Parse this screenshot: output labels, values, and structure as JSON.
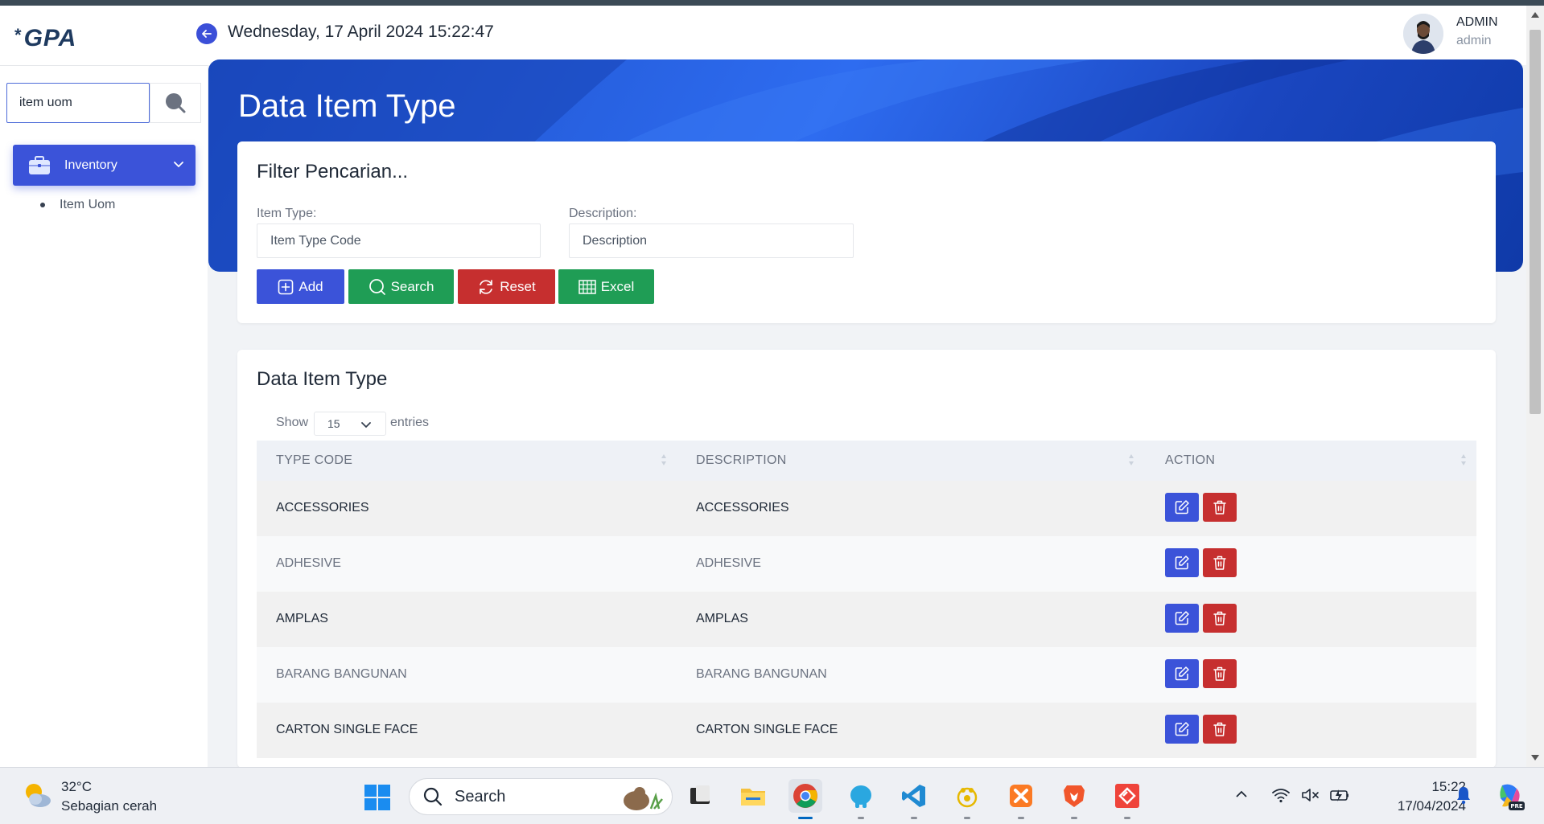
{
  "header": {
    "logo": "GPA",
    "datetime": "Wednesday, 17 April 2024 15:22:47",
    "user_name": "ADMIN",
    "user_role": "admin"
  },
  "sidebar": {
    "search_value": "item uom",
    "menu": {
      "label": "Inventory"
    },
    "sub_items": [
      {
        "label": "Item Uom"
      }
    ]
  },
  "page": {
    "title": "Data Item Type"
  },
  "filter": {
    "title": "Filter Pencarian...",
    "item_type_label": "Item Type:",
    "item_type_placeholder": "Item Type Code",
    "description_label": "Description:",
    "description_placeholder": "Description",
    "buttons": {
      "add": "Add",
      "search": "Search",
      "reset": "Reset",
      "excel": "Excel"
    }
  },
  "table": {
    "title": "Data Item Type",
    "show_label": "Show",
    "entries_value": "15",
    "entries_label": "entries",
    "columns": [
      "TYPE CODE",
      "DESCRIPTION",
      "ACTION"
    ],
    "rows": [
      {
        "code": "ACCESSORIES",
        "description": "ACCESSORIES"
      },
      {
        "code": "ADHESIVE",
        "description": "ADHESIVE"
      },
      {
        "code": "AMPLAS",
        "description": "AMPLAS"
      },
      {
        "code": "BARANG BANGUNAN",
        "description": "BARANG BANGUNAN"
      },
      {
        "code": "CARTON SINGLE FACE",
        "description": "CARTON SINGLE FACE"
      }
    ]
  },
  "taskbar": {
    "weather_temp": "32°C",
    "weather_desc": "Sebagian cerah",
    "search_label": "Search",
    "time": "15:22",
    "date": "17/04/2024"
  },
  "colors": {
    "primary": "#3b53d9",
    "success": "#1f9d55",
    "danger": "#c62f2f",
    "banner": "#2e6cf0"
  }
}
